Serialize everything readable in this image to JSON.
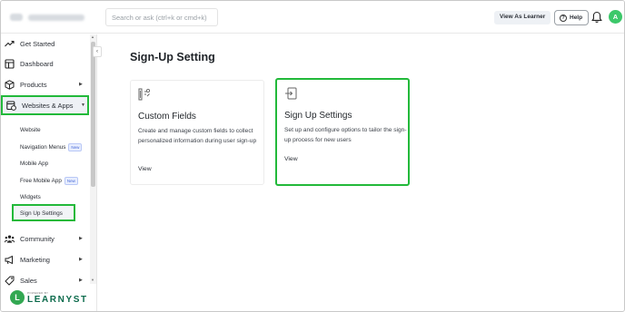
{
  "topbar": {
    "search_placeholder": "Search or ask (ctrl+k or cmd+k)",
    "view_as_learner": "View As Learner",
    "help": "Help",
    "avatar_initial": "A"
  },
  "sidebar": {
    "items": [
      {
        "label": "Get Started",
        "icon": "trend-icon"
      },
      {
        "label": "Dashboard",
        "icon": "dashboard-icon"
      },
      {
        "label": "Products",
        "icon": "box-icon"
      },
      {
        "label": "Websites & Apps",
        "icon": "website-icon"
      },
      {
        "label": "Community",
        "icon": "community-icon"
      },
      {
        "label": "Marketing",
        "icon": "megaphone-icon"
      },
      {
        "label": "Sales",
        "icon": "tag-icon"
      }
    ],
    "subitems": [
      {
        "label": "Website"
      },
      {
        "label": "Navigation Menus",
        "badge": "New"
      },
      {
        "label": "Mobile App"
      },
      {
        "label": "Free Mobile App",
        "badge": "New"
      },
      {
        "label": "Widgets"
      },
      {
        "label": "Sign Up Settings"
      }
    ],
    "logo_powered": "POWERED BY",
    "logo_name": "LEARNYST",
    "logo_mark": "L"
  },
  "main": {
    "title": "Sign-Up Setting",
    "cards": [
      {
        "title": "Custom Fields",
        "description": "Create and manage custom fields to collect personalized information during user sign-up",
        "link": "View"
      },
      {
        "title": "Sign Up Settings",
        "description": "Set up and configure options to tailor the sign-up process for new users",
        "link": "View"
      }
    ]
  },
  "colors": {
    "highlight": "#22b93a",
    "avatar": "#3cc86a",
    "brand": "#0d6b4c"
  }
}
